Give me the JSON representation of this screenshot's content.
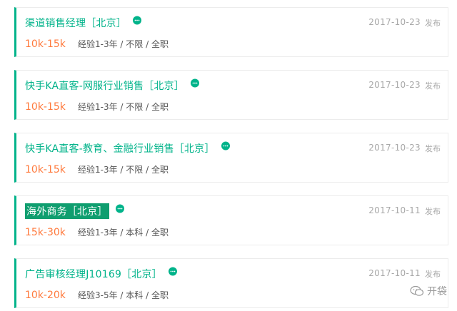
{
  "jobs": [
    {
      "title": "渠道销售经理［北京］",
      "date": "2017-10-23",
      "publish_label": "发布",
      "salary": "10k-15k",
      "requirements": "经验1-3年 / 不限 / 全职",
      "highlighted": false
    },
    {
      "title": "快手KA直客-网服行业销售［北京］",
      "date": "2017-10-23",
      "publish_label": "发布",
      "salary": "10k-15k",
      "requirements": "经验1-3年 / 不限 / 全职",
      "highlighted": false
    },
    {
      "title": "快手KA直客-教育、金融行业销售［北京］",
      "date": "2017-10-23",
      "publish_label": "发布",
      "salary": "10k-15k",
      "requirements": "经验1-3年 / 不限 / 全职",
      "highlighted": false
    },
    {
      "title": "海外商务［北京］",
      "date": "2017-10-11",
      "publish_label": "发布",
      "salary": "15k-30k",
      "requirements": "经验1-3年 / 本科 / 全职",
      "highlighted": true
    },
    {
      "title": "广告审核经理J10169［北京］",
      "date": "2017-10-11",
      "publish_label": "发布",
      "salary": "10k-20k",
      "requirements": "经验3-5年 / 本科 / 全职",
      "highlighted": false
    }
  ],
  "watermark": {
    "text": "开袋",
    "icon": "wechat-logo-icon"
  },
  "colors": {
    "accent": "#00b38a",
    "salary": "#ff7a3d",
    "muted": "#a8a8a8",
    "highlight_bg": "#0f9e6f"
  }
}
